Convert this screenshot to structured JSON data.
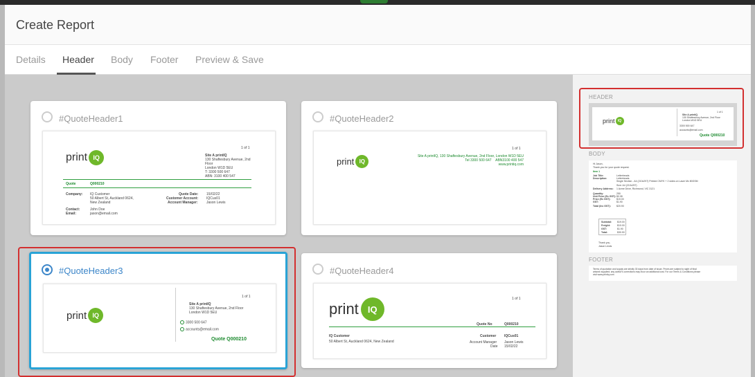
{
  "modal": {
    "title": "Create Report"
  },
  "tabs": [
    "Details",
    "Header",
    "Body",
    "Footer",
    "Preview & Save"
  ],
  "active_tab": "Header",
  "logo": {
    "text": "print",
    "badge": "IQ",
    "brand_color": "#6fb82a"
  },
  "cards": [
    {
      "name": "#QuoteHeader1",
      "selected": false,
      "page": "1 of 1",
      "site": [
        "Site A printIQ",
        "130 Shaftesbury Avenue, 2nd",
        "Floor",
        "London W1D 5EU",
        "T: 3300 500 647",
        "ABN: 3100 400 547"
      ],
      "quote_label": "Quote",
      "quote_no": "Q000210",
      "company_label": "Company:",
      "company": [
        "IQ Customer",
        "50 Albert St, Auckland 0624,",
        "New Zealand"
      ],
      "contact_label": "Contact:",
      "contact": "John Doe",
      "email_label": "Email:",
      "email": "jason@email.com",
      "quote_date_label": "Quote Date:",
      "quote_date": "15/02/22",
      "customer_account_label": "Customer Account:",
      "customer_account": "IQCus01",
      "account_manager_label": "Account Manager:",
      "account_manager": "Jason Lewis"
    },
    {
      "name": "#QuoteHeader2",
      "selected": false,
      "page": "1 of 1",
      "site": "Site A printIQ, 130 Shaftesbury Avenue, 2nd Floor, London W1D 5EU",
      "phone": "Tel 3300 500 647",
      "abn": "ABN3100 400 547",
      "web": "www.printiq.com"
    },
    {
      "name": "#QuoteHeader3",
      "selected": true,
      "page": "1 of 1",
      "site": [
        "Site A printIQ",
        "130 Shaftesbury Avenue, 2nd Floor",
        "London W1D 5EU"
      ],
      "phone": "3300 500 647",
      "email": "accounts@email.com",
      "quote": "Quote Q000210"
    },
    {
      "name": "#QuoteHeader4",
      "selected": false,
      "page": "1 of 1",
      "quote_no_label": "Quote No",
      "quote_no": "Q000210",
      "customer_label": "Customer",
      "customer_code": "IQCus01",
      "customer_name": "IQ Customer",
      "customer_address": "50 Albert St, Auckland 0624, New Zealand",
      "account_manager_label": "Account Manager",
      "account_manager": "Jason Lewis",
      "date_label": "Date",
      "date": "15/02/22"
    }
  ],
  "side": {
    "header_label": "HEADER",
    "body_label": "BODY",
    "footer_label": "FOOTER",
    "mini_header": {
      "page": "1 of 1",
      "site": [
        "Site A printIQ",
        "130 Shaftesbury Avenue, 2nd Floor",
        "London W1D 5EU"
      ],
      "phone": "3300 500 647",
      "email": "accounts@email.com",
      "quote": "Quote Q000210"
    },
    "mini_body": {
      "greeting": "Hi Jason,",
      "thanks": "Thank you for your quote request.",
      "item": "Item 1",
      "lines": [
        [
          "Job Title:",
          "Letterheads"
        ],
        [
          "Description:",
          "Letterheads"
        ],
        [
          "",
          "Single Section - A4 (210x297) Printed CMYK + 2 sides on Laser Mx 80GSM"
        ],
        [
          "",
          "Size: A4 (210x297)"
        ],
        [
          "Delivery Address:",
          "1 Acme Drive, Richmond, VIC 3121"
        ],
        [
          "Quantity:",
          "250"
        ],
        [
          "Unit Price (Ex GST):",
          "$0.08"
        ],
        [
          "Price (Ex GST):",
          "$19.00"
        ],
        [
          "GST:",
          "$1.90"
        ],
        [
          "Total (Inc GST):",
          "$20.90"
        ]
      ],
      "totals": [
        [
          "Subtotal:",
          "$19.00"
        ],
        [
          "Freight:",
          "$10.00"
        ],
        [
          "GST:",
          "$1.90"
        ],
        [
          "Total:",
          "$30.90"
        ]
      ],
      "sign": [
        "Thank you,",
        "Jason Lewis"
      ]
    },
    "mini_footer": [
      "Terms of quotation and supply are strictly 30 days from date of issue. Prices are subject to sight of final",
      "artwork supplied; any author's corrections may incur an additional cost. For our Terms & Conditions please",
      "visit www.printiq.com"
    ]
  }
}
